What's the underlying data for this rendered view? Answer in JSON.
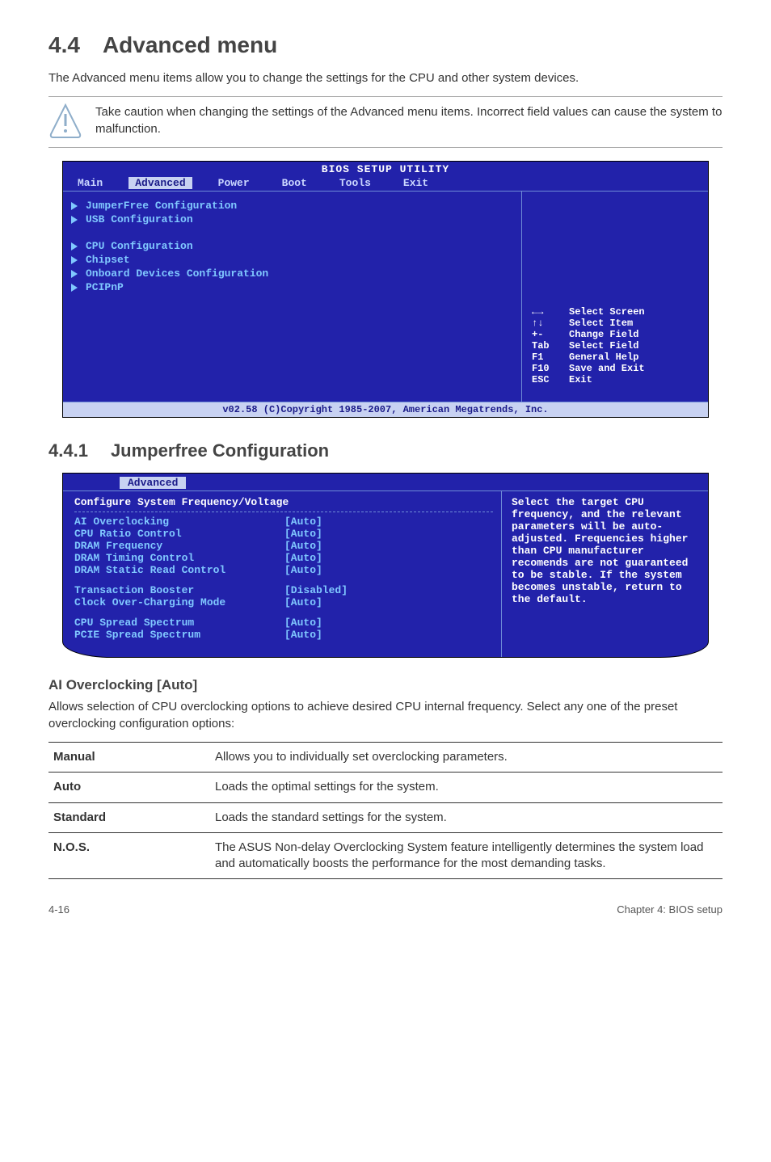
{
  "section": {
    "number": "4.4",
    "title": "Advanced menu"
  },
  "intro": "The Advanced menu items allow you to change the settings for the CPU and other system devices.",
  "note": "Take caution when changing the settings of the Advanced menu items. Incorrect field values can cause the system to malfunction.",
  "bios": {
    "title": "BIOS SETUP UTILITY",
    "tabs": [
      "Main",
      "Advanced",
      "Power",
      "Boot",
      "Tools",
      "Exit"
    ],
    "active_tab": "Advanced",
    "left_group1": [
      "JumperFree Configuration",
      "USB Configuration"
    ],
    "left_group2": [
      "CPU Configuration",
      "Chipset",
      "Onboard Devices Configuration",
      "PCIPnP"
    ],
    "help": [
      {
        "key_icon": "arrows-lr",
        "text": "Select Screen"
      },
      {
        "key_icon": "arrows-ud",
        "text": "Select Item"
      },
      {
        "key": "+-",
        "text": "Change Field"
      },
      {
        "key": "Tab",
        "text": "Select Field"
      },
      {
        "key": "F1",
        "text": "General Help"
      },
      {
        "key": "F10",
        "text": "Save and Exit"
      },
      {
        "key": "ESC",
        "text": "Exit"
      }
    ],
    "footer": "v02.58 (C)Copyright 1985-2007, American Megatrends, Inc."
  },
  "subsection": {
    "number": "4.4.1",
    "title": "Jumperfree Configuration"
  },
  "bios2": {
    "tab": "Advanced",
    "header": "Configure System Frequency/Voltage",
    "rows": [
      {
        "label": "AI Overclocking",
        "value": "[Auto]"
      },
      {
        "label": "CPU Ratio Control",
        "value": "[Auto]"
      },
      {
        "label": "DRAM Frequency",
        "value": "[Auto]"
      },
      {
        "label": "DRAM Timing Control",
        "value": "[Auto]"
      },
      {
        "label": "DRAM Static Read Control",
        "value": "[Auto]"
      }
    ],
    "rows2": [
      {
        "label": "Transaction Booster",
        "value": "[Disabled]"
      },
      {
        "label": "Clock Over-Charging Mode",
        "value": "[Auto]"
      }
    ],
    "rows3": [
      {
        "label": "CPU Spread Spectrum",
        "value": "[Auto]"
      },
      {
        "label": "PCIE Spread Spectrum",
        "value": "[Auto]"
      }
    ],
    "right_text": "Select the target CPU frequency, and the relevant parameters will be auto-adjusted. Frequencies higher than CPU manufacturer recomends are not guaranteed to be stable. If the system becomes unstable, return to the default."
  },
  "field": {
    "title": "AI Overclocking [Auto]",
    "desc": "Allows selection of CPU overclocking options to achieve desired CPU internal frequency. Select any one of the preset overclocking configuration options:"
  },
  "table": [
    {
      "key": "Manual",
      "desc": "Allows you to individually set overclocking parameters."
    },
    {
      "key": "Auto",
      "desc": "Loads the optimal settings for the system."
    },
    {
      "key": "Standard",
      "desc": "Loads the standard settings for the system."
    },
    {
      "key": "N.O.S.",
      "desc": "The ASUS Non-delay Overclocking System feature intelligently determines the system load and automatically boosts the performance for the most demanding tasks."
    }
  ],
  "footer": {
    "left": "4-16",
    "right": "Chapter 4: BIOS setup"
  }
}
